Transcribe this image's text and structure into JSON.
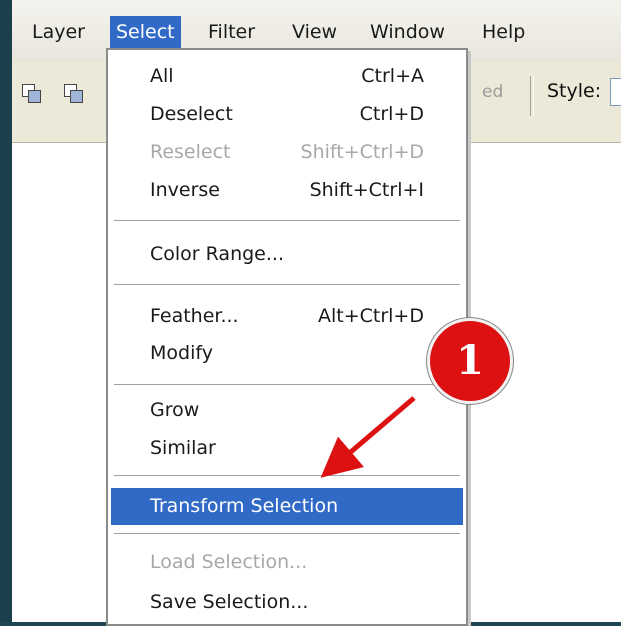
{
  "menubar": {
    "items": [
      {
        "label": "Layer"
      },
      {
        "label": "Select"
      },
      {
        "label": "Filter"
      },
      {
        "label": "View"
      },
      {
        "label": "Window"
      },
      {
        "label": "Help"
      }
    ]
  },
  "toolbar": {
    "faded_text": "ed",
    "style_label": "Style:"
  },
  "select_menu": {
    "items": [
      {
        "label": "All",
        "shortcut": "Ctrl+A"
      },
      {
        "label": "Deselect",
        "shortcut": "Ctrl+D"
      },
      {
        "label": "Reselect",
        "shortcut": "Shift+Ctrl+D",
        "disabled": true
      },
      {
        "label": "Inverse",
        "shortcut": "Shift+Ctrl+I"
      },
      {
        "label": "Color Range..."
      },
      {
        "label": "Feather...",
        "shortcut": "Alt+Ctrl+D"
      },
      {
        "label": "Modify"
      },
      {
        "label": "Grow"
      },
      {
        "label": "Similar"
      },
      {
        "label": "Transform Selection",
        "highlighted": true
      },
      {
        "label": "Load Selection...",
        "disabled": true
      },
      {
        "label": "Save Selection..."
      }
    ]
  },
  "annotation": {
    "badge_number": "1",
    "badge_color": "#dd1111",
    "arrow_color": "#dd1111"
  },
  "colors": {
    "menu_highlight": "#3169c6",
    "background_frame": "#1e4552"
  }
}
